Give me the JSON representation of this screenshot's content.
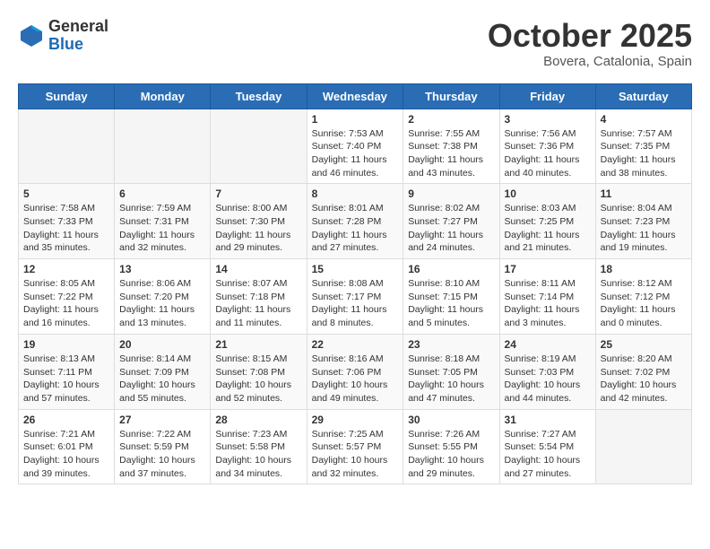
{
  "header": {
    "logo_general": "General",
    "logo_blue": "Blue",
    "month": "October 2025",
    "location": "Bovera, Catalonia, Spain"
  },
  "weekdays": [
    "Sunday",
    "Monday",
    "Tuesday",
    "Wednesday",
    "Thursday",
    "Friday",
    "Saturday"
  ],
  "weeks": [
    [
      {
        "day": "",
        "info": ""
      },
      {
        "day": "",
        "info": ""
      },
      {
        "day": "",
        "info": ""
      },
      {
        "day": "1",
        "info": "Sunrise: 7:53 AM\nSunset: 7:40 PM\nDaylight: 11 hours and 46 minutes."
      },
      {
        "day": "2",
        "info": "Sunrise: 7:55 AM\nSunset: 7:38 PM\nDaylight: 11 hours and 43 minutes."
      },
      {
        "day": "3",
        "info": "Sunrise: 7:56 AM\nSunset: 7:36 PM\nDaylight: 11 hours and 40 minutes."
      },
      {
        "day": "4",
        "info": "Sunrise: 7:57 AM\nSunset: 7:35 PM\nDaylight: 11 hours and 38 minutes."
      }
    ],
    [
      {
        "day": "5",
        "info": "Sunrise: 7:58 AM\nSunset: 7:33 PM\nDaylight: 11 hours and 35 minutes."
      },
      {
        "day": "6",
        "info": "Sunrise: 7:59 AM\nSunset: 7:31 PM\nDaylight: 11 hours and 32 minutes."
      },
      {
        "day": "7",
        "info": "Sunrise: 8:00 AM\nSunset: 7:30 PM\nDaylight: 11 hours and 29 minutes."
      },
      {
        "day": "8",
        "info": "Sunrise: 8:01 AM\nSunset: 7:28 PM\nDaylight: 11 hours and 27 minutes."
      },
      {
        "day": "9",
        "info": "Sunrise: 8:02 AM\nSunset: 7:27 PM\nDaylight: 11 hours and 24 minutes."
      },
      {
        "day": "10",
        "info": "Sunrise: 8:03 AM\nSunset: 7:25 PM\nDaylight: 11 hours and 21 minutes."
      },
      {
        "day": "11",
        "info": "Sunrise: 8:04 AM\nSunset: 7:23 PM\nDaylight: 11 hours and 19 minutes."
      }
    ],
    [
      {
        "day": "12",
        "info": "Sunrise: 8:05 AM\nSunset: 7:22 PM\nDaylight: 11 hours and 16 minutes."
      },
      {
        "day": "13",
        "info": "Sunrise: 8:06 AM\nSunset: 7:20 PM\nDaylight: 11 hours and 13 minutes."
      },
      {
        "day": "14",
        "info": "Sunrise: 8:07 AM\nSunset: 7:18 PM\nDaylight: 11 hours and 11 minutes."
      },
      {
        "day": "15",
        "info": "Sunrise: 8:08 AM\nSunset: 7:17 PM\nDaylight: 11 hours and 8 minutes."
      },
      {
        "day": "16",
        "info": "Sunrise: 8:10 AM\nSunset: 7:15 PM\nDaylight: 11 hours and 5 minutes."
      },
      {
        "day": "17",
        "info": "Sunrise: 8:11 AM\nSunset: 7:14 PM\nDaylight: 11 hours and 3 minutes."
      },
      {
        "day": "18",
        "info": "Sunrise: 8:12 AM\nSunset: 7:12 PM\nDaylight: 11 hours and 0 minutes."
      }
    ],
    [
      {
        "day": "19",
        "info": "Sunrise: 8:13 AM\nSunset: 7:11 PM\nDaylight: 10 hours and 57 minutes."
      },
      {
        "day": "20",
        "info": "Sunrise: 8:14 AM\nSunset: 7:09 PM\nDaylight: 10 hours and 55 minutes."
      },
      {
        "day": "21",
        "info": "Sunrise: 8:15 AM\nSunset: 7:08 PM\nDaylight: 10 hours and 52 minutes."
      },
      {
        "day": "22",
        "info": "Sunrise: 8:16 AM\nSunset: 7:06 PM\nDaylight: 10 hours and 49 minutes."
      },
      {
        "day": "23",
        "info": "Sunrise: 8:18 AM\nSunset: 7:05 PM\nDaylight: 10 hours and 47 minutes."
      },
      {
        "day": "24",
        "info": "Sunrise: 8:19 AM\nSunset: 7:03 PM\nDaylight: 10 hours and 44 minutes."
      },
      {
        "day": "25",
        "info": "Sunrise: 8:20 AM\nSunset: 7:02 PM\nDaylight: 10 hours and 42 minutes."
      }
    ],
    [
      {
        "day": "26",
        "info": "Sunrise: 7:21 AM\nSunset: 6:01 PM\nDaylight: 10 hours and 39 minutes."
      },
      {
        "day": "27",
        "info": "Sunrise: 7:22 AM\nSunset: 5:59 PM\nDaylight: 10 hours and 37 minutes."
      },
      {
        "day": "28",
        "info": "Sunrise: 7:23 AM\nSunset: 5:58 PM\nDaylight: 10 hours and 34 minutes."
      },
      {
        "day": "29",
        "info": "Sunrise: 7:25 AM\nSunset: 5:57 PM\nDaylight: 10 hours and 32 minutes."
      },
      {
        "day": "30",
        "info": "Sunrise: 7:26 AM\nSunset: 5:55 PM\nDaylight: 10 hours and 29 minutes."
      },
      {
        "day": "31",
        "info": "Sunrise: 7:27 AM\nSunset: 5:54 PM\nDaylight: 10 hours and 27 minutes."
      },
      {
        "day": "",
        "info": ""
      }
    ]
  ]
}
